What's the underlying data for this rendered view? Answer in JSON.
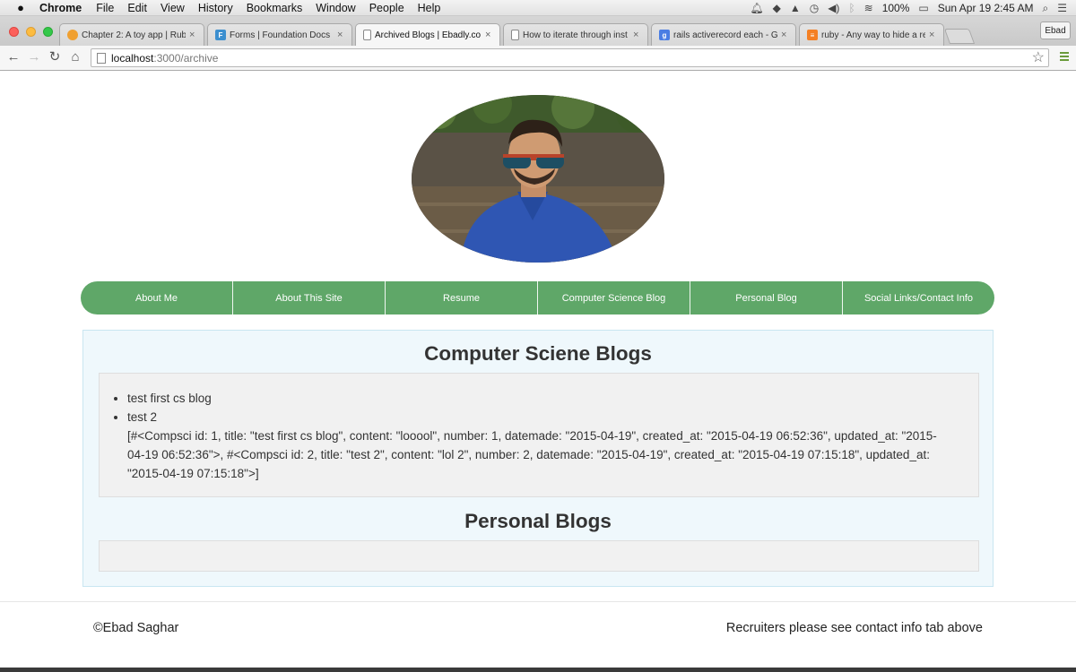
{
  "menubar": {
    "apple": "",
    "app_name": "Chrome",
    "items": [
      "File",
      "Edit",
      "View",
      "History",
      "Bookmarks",
      "Window",
      "People",
      "Help"
    ],
    "battery": "100%",
    "datetime": "Sun Apr 19  2:45 AM"
  },
  "browser": {
    "tabs": [
      {
        "title": "Chapter 2: A toy app | Rub",
        "icon": "ruby-book-icon",
        "color": "#f0a030"
      },
      {
        "title": "Forms | Foundation Docs",
        "icon": "foundation-icon",
        "color": "#3c8fcf"
      },
      {
        "title": "Archived Blogs | Ebadly.co",
        "icon": "page-icon",
        "color": "#ffffff"
      },
      {
        "title": "How to iterate through inst",
        "icon": "page-icon",
        "color": "#ffffff"
      },
      {
        "title": "rails activerecord each - Go",
        "icon": "google-icon",
        "color": "#4a7de3"
      },
      {
        "title": "ruby - Any way to hide a re",
        "icon": "stackoverflow-icon",
        "color": "#f48024"
      }
    ],
    "profile": "Ebad",
    "url_host": "localhost",
    "url_path": ":3000/archive"
  },
  "site": {
    "nav": [
      "About Me",
      "About This Site",
      "Resume",
      "Computer Science Blog",
      "Personal Blog",
      "Social Links/Contact Info"
    ],
    "cs_title": "Computer Sciene Blogs",
    "cs_items": [
      "test first cs blog",
      "test 2"
    ],
    "cs_dump": "[#<Compsci id: 1, title: \"test first cs blog\", content: \"looool\", number: 1, datemade: \"2015-04-19\", created_at: \"2015-04-19 06:52:36\", updated_at: \"2015-04-19 06:52:36\">, #<Compsci id: 2, title: \"test 2\", content: \"lol 2\", number: 2, datemade: \"2015-04-19\", created_at: \"2015-04-19 07:15:18\", updated_at: \"2015-04-19 07:15:18\">]",
    "personal_title": "Personal Blogs",
    "footer_left": "©Ebad Saghar",
    "footer_right": "Recruiters please see contact info tab above"
  },
  "colors": {
    "nav_green": "#5fa768",
    "panel_bg": "#eff8fc",
    "well_bg": "#f1f1f1"
  }
}
